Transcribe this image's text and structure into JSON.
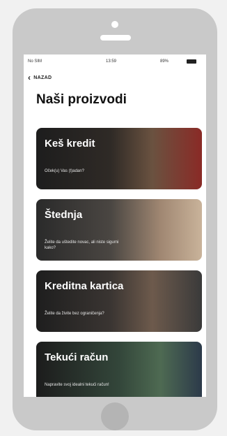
{
  "status_bar": {
    "carrier": "No SIM ",
    "time": "13:59",
    "battery": "89%"
  },
  "nav": {
    "back_label": "NAZAD"
  },
  "page": {
    "title": "Naši proizvodi"
  },
  "cards": [
    {
      "title": "Keš kredit",
      "subtitle": "Oček(u) Vas (t)adan?"
    },
    {
      "title": "Štednja",
      "subtitle": "Želite da uštedite novac, ali niste sigurni kako?"
    },
    {
      "title": "Kreditna kartica",
      "subtitle": "Želite da živite bez ograničenja?"
    },
    {
      "title": "Tekući račun",
      "subtitle": "Napravite svoj idealni tekući račun!"
    }
  ],
  "colors": {
    "phone_frame": "#c9c9c9",
    "background": "#f1f1f1",
    "card_text": "#ffffff"
  }
}
